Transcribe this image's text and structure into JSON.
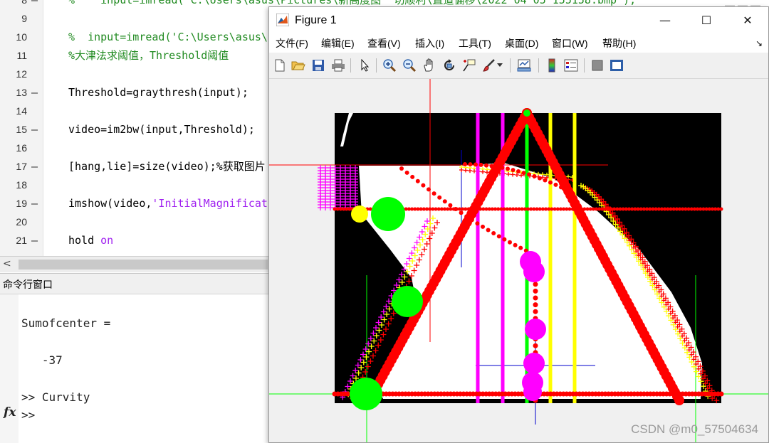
{
  "editor": {
    "lines": [
      {
        "num": "8",
        "dash": "—",
        "code": "%    input=imread('C:\\Users\\asus\\Pictures\\新高度图  切顺利\\直道偏移\\2022 04 05 155158.bmp');",
        "kind": "comment"
      },
      {
        "num": "9",
        "dash": "",
        "code": "",
        "kind": "code"
      },
      {
        "num": "10",
        "dash": "",
        "code": "%  input=imread('C:\\Users\\asus\\",
        "kind": "comment"
      },
      {
        "num": "11",
        "dash": "",
        "code": "%大津法求阈值，Threshold阈值",
        "kind": "comment"
      },
      {
        "num": "12",
        "dash": "",
        "code": "",
        "kind": "code"
      },
      {
        "num": "13",
        "dash": "—",
        "code": "Threshold=graythresh(input);",
        "kind": "code"
      },
      {
        "num": "14",
        "dash": "",
        "code": "",
        "kind": "code"
      },
      {
        "num": "15",
        "dash": "—",
        "code": "video=im2bw(input,Threshold);",
        "kind": "code"
      },
      {
        "num": "16",
        "dash": "",
        "code": "",
        "kind": "code"
      },
      {
        "num": "17",
        "dash": "—",
        "code": "[hang,lie]=size(video);%获取图片",
        "kind": "code"
      },
      {
        "num": "18",
        "dash": "",
        "code": "",
        "kind": "code"
      },
      {
        "num": "19",
        "dash": "—",
        "code_pre": "imshow(video,",
        "code_str": "'InitialMagnificati",
        "kind": "mixed"
      },
      {
        "num": "20",
        "dash": "",
        "code": "",
        "kind": "code"
      },
      {
        "num": "21",
        "dash": "—",
        "code_pre": "hold ",
        "code_str": "on",
        "kind": "mixed"
      }
    ],
    "scroll_left_arrow": "<"
  },
  "command_window": {
    "title": "命令行窗口",
    "lines": [
      "Sumofcenter =",
      "",
      "   -37",
      "",
      ">> Curvity"
    ],
    "prompt": ">>",
    "fx_label": "fx"
  },
  "figure": {
    "title": "Figure 1",
    "window_buttons": {
      "minimize": "—",
      "maximize": "☐",
      "close": "✕"
    },
    "menu": [
      "文件(F)",
      "编辑(E)",
      "查看(V)",
      "插入(I)",
      "工具(T)",
      "桌面(D)",
      "窗口(W)",
      "帮助(H)"
    ],
    "menu_overflow": "↘",
    "toolbar_icons": [
      "new-figure-icon",
      "open-file-icon",
      "save-icon",
      "print-icon",
      "pointer-icon",
      "zoom-in-icon",
      "zoom-out-icon",
      "pan-hand-icon",
      "rotate-3d-icon",
      "data-cursor-icon",
      "brush-icon",
      "brush-dropdown-icon",
      "link-plot-icon",
      "colorbar-icon",
      "legend-icon",
      "hide-plot-tools-icon",
      "show-plot-tools-icon"
    ]
  },
  "colors": {
    "red": "#ff0000",
    "green": "#00ff00",
    "magenta": "#ff00ff",
    "yellow": "#ffff00",
    "blue": "#0000cc",
    "black": "#000000"
  },
  "watermark": "CSDN @m0_57504634"
}
